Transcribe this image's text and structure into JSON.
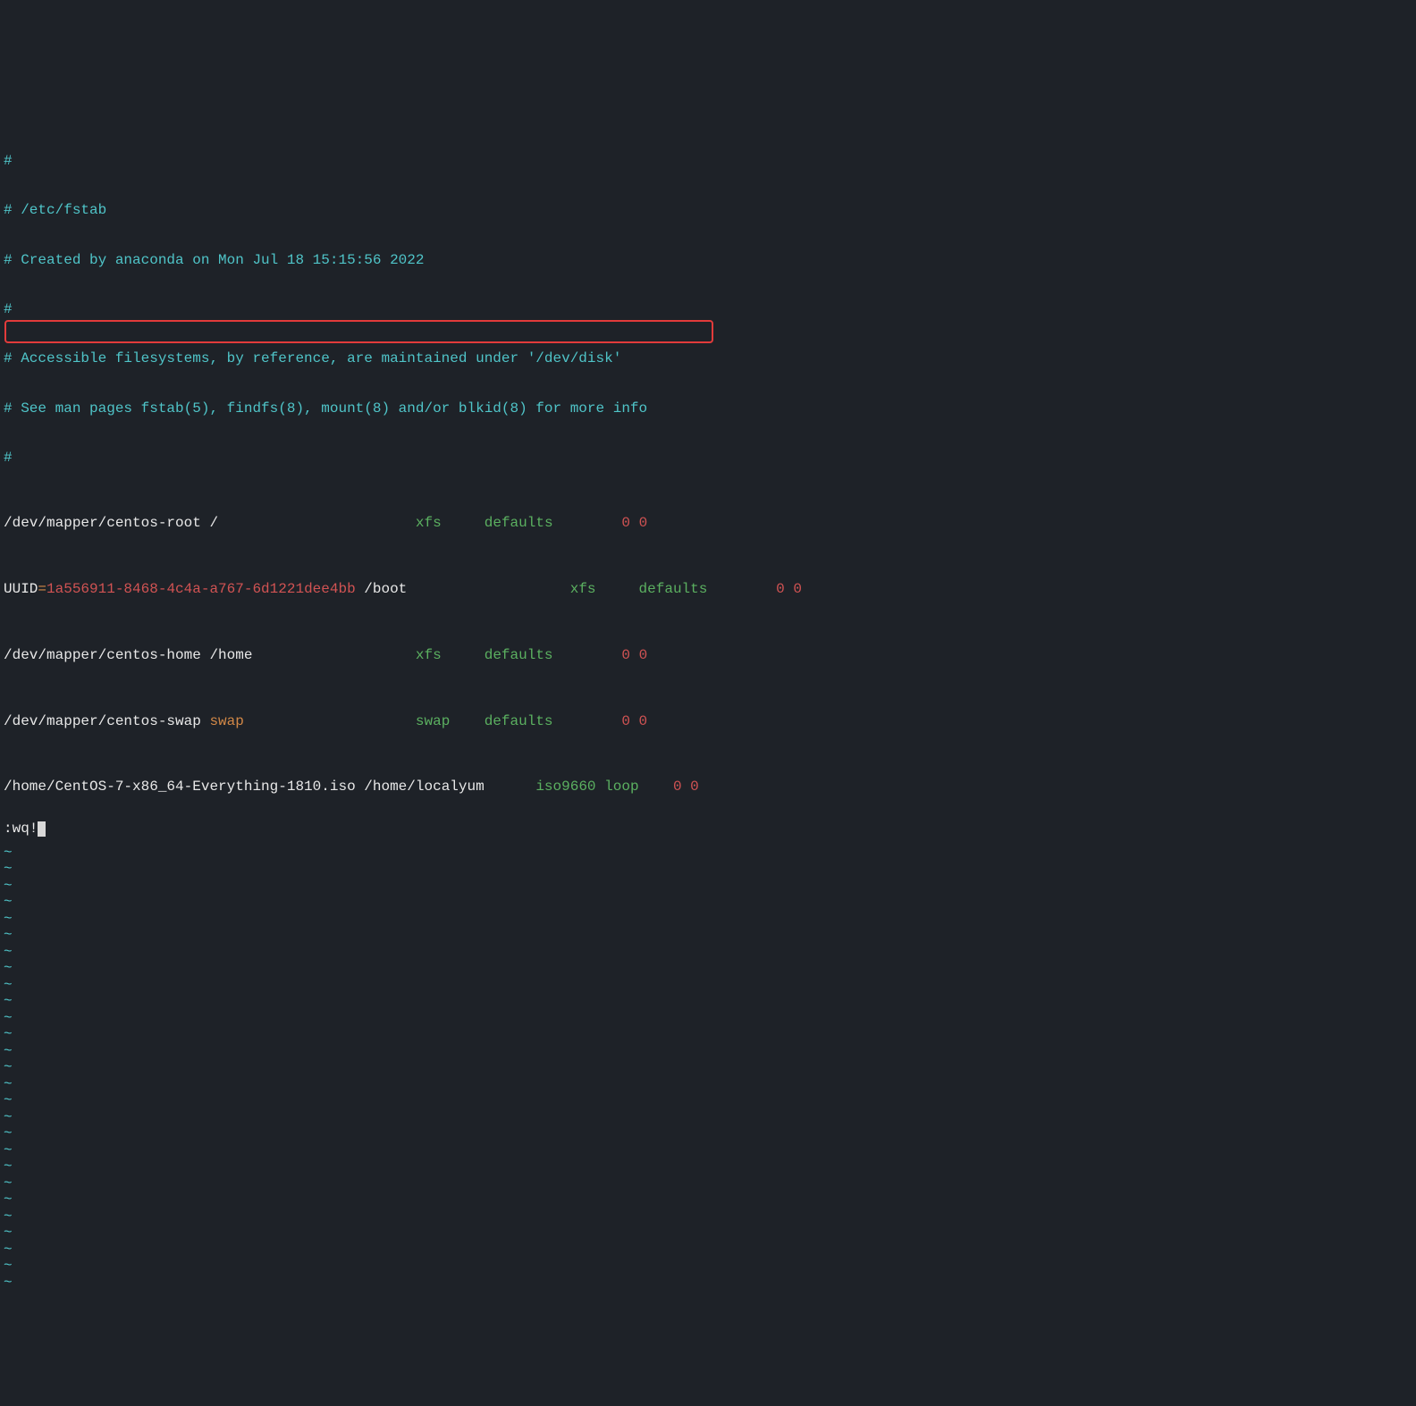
{
  "comments": [
    "#",
    "# /etc/fstab",
    "# Created by anaconda on Mon Jul 18 15:15:56 2022",
    "#",
    "# Accessible filesystems, by reference, are maintained under '/dev/disk'",
    "# See man pages fstab(5), findfs(8), mount(8) and/or blkid(8) for more info",
    "#"
  ],
  "entries": [
    {
      "device": "/dev/mapper/centos-root",
      "mount": "/",
      "spacer1": "                       ",
      "fs": "xfs",
      "spacer2": "     ",
      "opts": "defaults",
      "spacer3": "        ",
      "dump": "0",
      "pass": "0"
    },
    {
      "prefix": "UUID",
      "eq": "=",
      "uuid": "1a556911-8468-4c4a-a767-6d1221dee4bb",
      "mount": " /boot",
      "spacer1": "                   ",
      "fs": "xfs",
      "spacer2": "     ",
      "opts": "defaults",
      "spacer3": "        ",
      "dump": "0",
      "pass": "0"
    },
    {
      "device": "/dev/mapper/centos-home",
      "mount": " /home",
      "spacer1": "                   ",
      "fs": "xfs",
      "spacer2": "     ",
      "opts": "defaults",
      "spacer3": "        ",
      "dump": "0",
      "pass": "0"
    },
    {
      "device": "/dev/mapper/centos-swap",
      "mount": " swap",
      "spacer1": "                    ",
      "fs": "swap",
      "spacer2": "    ",
      "opts": "defaults",
      "spacer3": "        ",
      "dump": "0",
      "pass": "0"
    },
    {
      "device": "/home/CentOS-7-x86_64-Everything-1810.iso",
      "mount": " /home/localyum",
      "spacer1": "      ",
      "fs": "iso9660",
      "spacer2": " ",
      "opts": "loop",
      "spacer3": "    ",
      "dump": "0",
      "pass": "0"
    }
  ],
  "tilde": "~",
  "tilde_count": 27,
  "command": ":wq!"
}
